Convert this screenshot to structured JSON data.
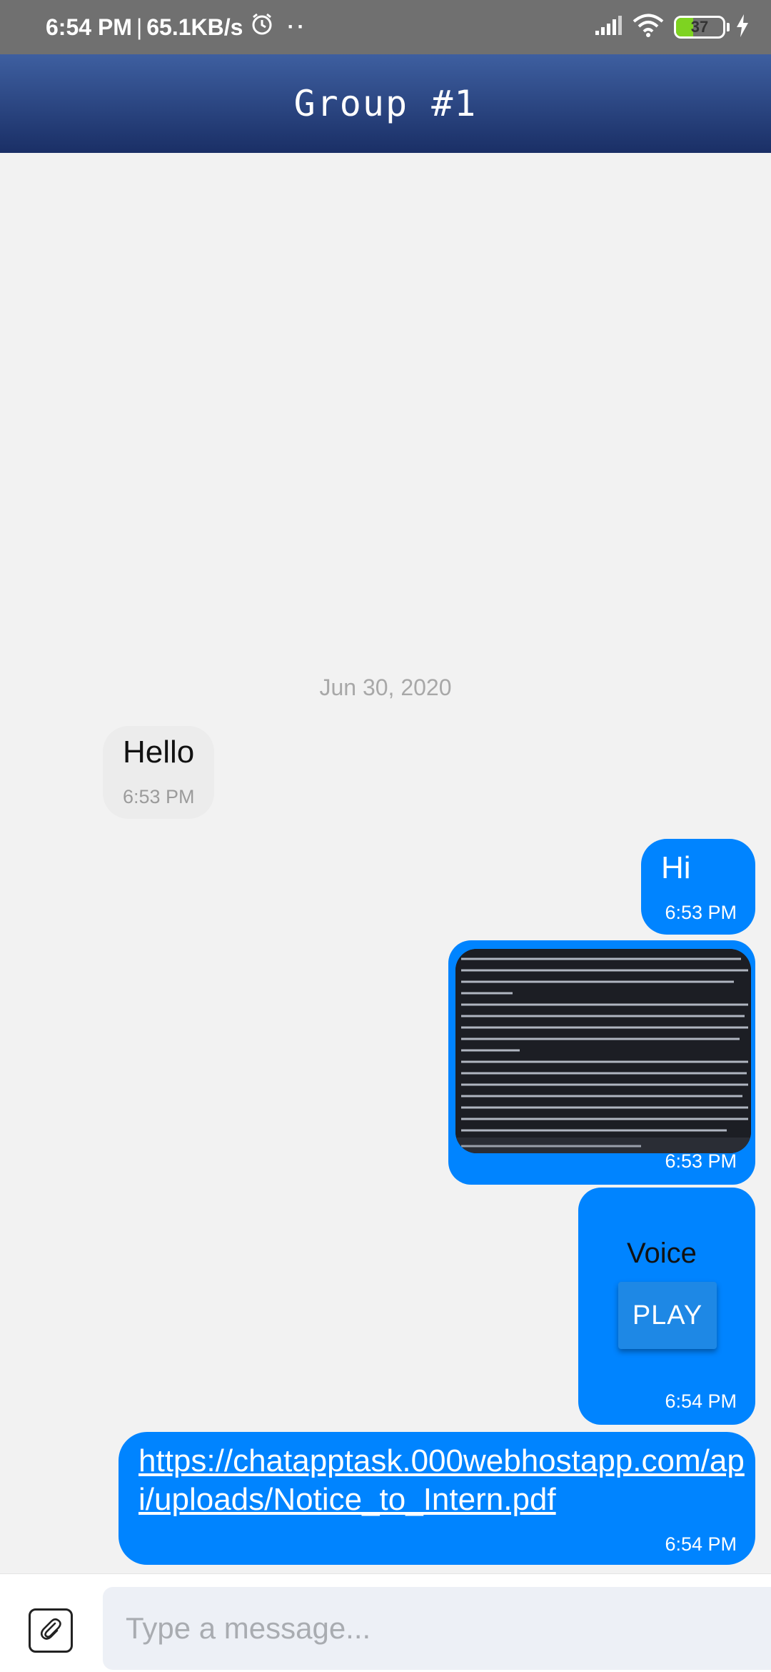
{
  "status_bar": {
    "time": "6:54 PM",
    "network_speed": "65.1KB/s",
    "battery_level": "37",
    "icons": [
      "alarm-icon",
      "more-dots-icon",
      "signal-icon",
      "wifi-icon",
      "battery-icon",
      "charging-bolt-icon"
    ]
  },
  "header": {
    "title": "Group #1"
  },
  "chat": {
    "date_separator": "Jun 30, 2020",
    "messages": [
      {
        "direction": "incoming",
        "type": "text",
        "text": "Hello",
        "time": "6:53 PM"
      },
      {
        "direction": "outgoing",
        "type": "text",
        "text": "Hi",
        "time": "6:53 PM"
      },
      {
        "direction": "outgoing",
        "type": "image",
        "time": "6:53 PM"
      },
      {
        "direction": "outgoing",
        "type": "voice",
        "label": "Voice",
        "button": "PLAY",
        "time": "6:54 PM"
      },
      {
        "direction": "outgoing",
        "type": "link",
        "text": "https://chatapptask.000webhostapp.com/api/uploads/Notice_to_Intern.pdf",
        "time": "6:54 PM"
      }
    ]
  },
  "composer": {
    "placeholder": "Type a message..."
  },
  "colors": {
    "header_top": "#3e5fa0",
    "header_bottom": "#1a2f66",
    "outgoing_bubble": "#0084ff",
    "incoming_bubble": "#ececec",
    "play_button": "#1e88e5",
    "background": "#f2f2f2"
  }
}
